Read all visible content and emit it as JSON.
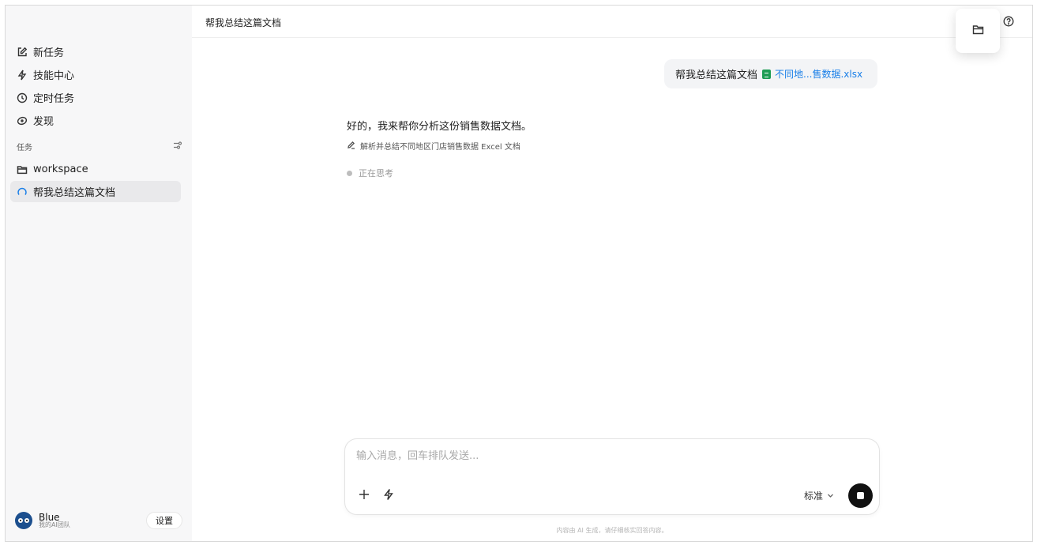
{
  "sidebar": {
    "nav": [
      {
        "label": "新任务",
        "icon": "edit-icon"
      },
      {
        "label": "技能中心",
        "icon": "bolt-icon"
      },
      {
        "label": "定时任务",
        "icon": "clock-icon"
      },
      {
        "label": "发现",
        "icon": "compass-icon"
      }
    ],
    "section_title": "任务",
    "tasks": [
      {
        "label": "workspace",
        "icon": "folder-icon"
      },
      {
        "label": "帮我总结这篇文档",
        "icon": "loading-spinner-icon",
        "active": true
      }
    ],
    "user": {
      "name": "Blue",
      "subtitle": "我的AI团队"
    },
    "settings_label": "设置"
  },
  "header": {
    "title": "帮我总结这篇文档"
  },
  "chat": {
    "user_message": {
      "text": "帮我总结这篇文档",
      "file_name": "不同地...售数据.xlsx"
    },
    "assistant_text": "好的，我来帮你分析这份销售数据文档。",
    "step_text": "解析并总结不同地区门店销售数据 Excel 文档",
    "thinking_text": "正在思考"
  },
  "composer": {
    "placeholder": "输入消息，回车排队发送...",
    "mode_label": "标准"
  },
  "footer": {
    "disclaimer": "内容由 AI 生成，请仔细核实回答内容。"
  },
  "colors": {
    "accent_link": "#1a7fe8",
    "xlsx_green": "#1f9d55",
    "sidebar_bg": "#f7f7f8"
  }
}
